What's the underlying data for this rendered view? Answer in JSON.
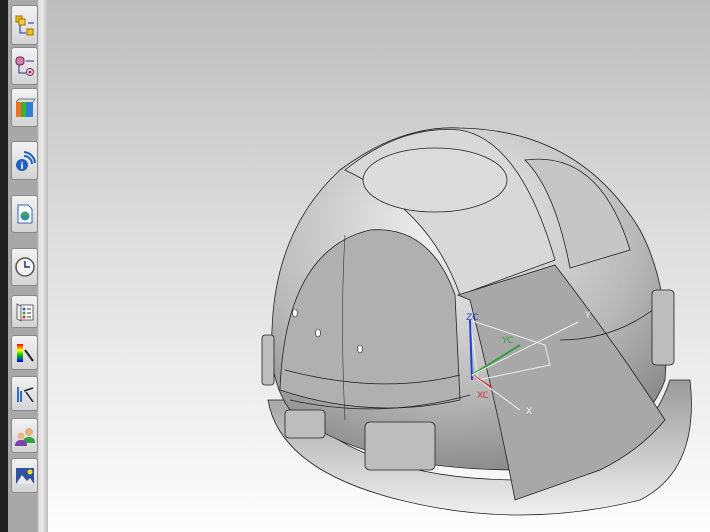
{
  "toolbar": {
    "buttons": [
      {
        "icon": "assembly-navigator-icon"
      },
      {
        "icon": "part-navigator-icon"
      },
      {
        "icon": "reuse-library-icon"
      },
      {
        "icon": "info-broadcast-icon"
      },
      {
        "icon": "web-browser-icon"
      },
      {
        "icon": "history-clock-icon"
      },
      {
        "icon": "system-materials-icon"
      },
      {
        "icon": "visualization-palette-icon"
      },
      {
        "icon": "analysis-icon"
      },
      {
        "icon": "roles-icon"
      },
      {
        "icon": "system-scenes-icon"
      }
    ]
  },
  "viewport": {
    "csys_labels": {
      "xc": "XC",
      "yc": "YC",
      "zc": "ZC",
      "x": "X",
      "y": "Y"
    },
    "colors": {
      "xc": "#d03030",
      "yc": "#30a040",
      "zc": "#2040d0",
      "background_top": "#bdbdbd",
      "background_bottom": "#fdfdfd"
    }
  }
}
